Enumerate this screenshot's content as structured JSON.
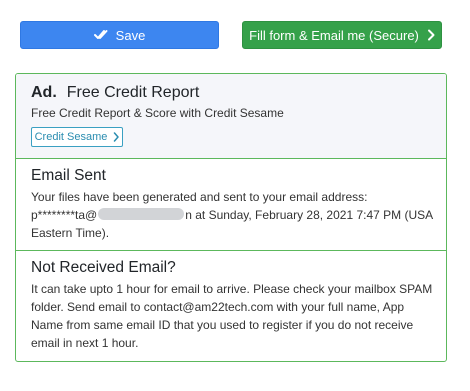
{
  "toolbar": {
    "save_label": "Save",
    "email_label": "Fill form & Email me (Secure)"
  },
  "ad": {
    "tag": "Ad.",
    "title": "Free Credit Report",
    "subtitle": "Free Credit Report & Score with Credit Sesame",
    "button_label": "Credit Sesame"
  },
  "email_sent": {
    "heading": "Email Sent",
    "line1": "Your files have been generated and sent to your email address:",
    "email_prefix": "p********ta@",
    "email_suffix": "n at Sunday, February 28, 2021 7:47 PM (USA Eastern Time)."
  },
  "not_received": {
    "heading": "Not Received Email?",
    "body": "It can take upto 1 hour for email to arrive. Please check your mailbox SPAM folder. Send email to contact@am22tech.com with your full name, App Name from same email ID that you used to register if you do not receive email in next 1 hour."
  },
  "colors": {
    "save_button": "#3d86f0",
    "email_button": "#35a14a",
    "panel_border": "#5cb85c"
  }
}
